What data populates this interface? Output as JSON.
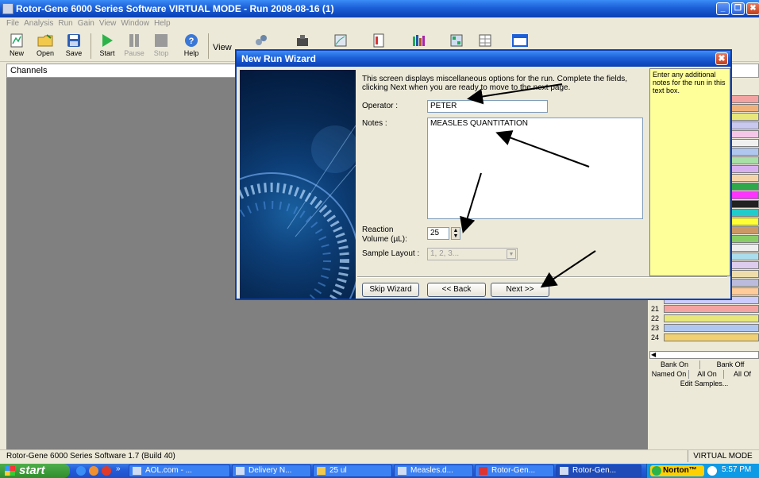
{
  "window": {
    "title": "Rotor-Gene 6000 Series Software VIRTUAL MODE - Run 2008-08-16 (1)",
    "minimize_label": "_",
    "maximize_label": "❐",
    "close_label": "✖"
  },
  "menu": [
    "File",
    "Analysis",
    "Run",
    "Gain",
    "View",
    "Window",
    "Help"
  ],
  "toolbar": {
    "new": "New",
    "open": "Open",
    "save": "Save",
    "start": "Start",
    "pause": "Pause",
    "stop": "Stop",
    "help": "Help",
    "view": "View"
  },
  "channels_label": "Channels",
  "dialog": {
    "title": "New Run Wizard",
    "close_label": "✖",
    "description": "This screen displays miscellaneous options for the run. Complete the fields, clicking Next when you are ready to move to the next page.",
    "operator_label": "Operator :",
    "operator_value": "PETER",
    "notes_label": "Notes :",
    "notes_value": "MEASLES QUANTITATION",
    "reaction_label": "Reaction Volume (µL):",
    "reaction_value": "25",
    "sample_layout_label": "Sample Layout :",
    "sample_layout_value": "1, 2, 3...",
    "side_note": "Enter any additional notes for the run in this text box.",
    "buttons": {
      "skip": "Skip Wizard",
      "back": "<< Back",
      "next": "Next >>"
    }
  },
  "right_panel": {
    "row_numbers": [
      "21",
      "22",
      "23",
      "24"
    ],
    "bank_on": "Bank On",
    "bank_off": "Bank Off",
    "named_on": "Named On",
    "all_on": "All On",
    "all_off": "All Of",
    "edit_samples": "Edit Samples..."
  },
  "status": {
    "left": "Rotor-Gene 6000 Series Software 1.7 (Build 40)",
    "right": "VIRTUAL MODE"
  },
  "taskbar": {
    "start": "start",
    "items": [
      "AOL.com - ...",
      "Delivery N...",
      "25 ul",
      "Measles.d...",
      "Rotor-Gen...",
      "Rotor-Gen..."
    ],
    "norton": "Norton™",
    "clock": "5:57 PM"
  },
  "colors": {
    "xp_blue": "#0a3fb3",
    "workspace_gray": "#808080",
    "note_yellow": "#ffff99",
    "taskbar_blue": "#245edb",
    "start_green": "#2f8d2c"
  }
}
